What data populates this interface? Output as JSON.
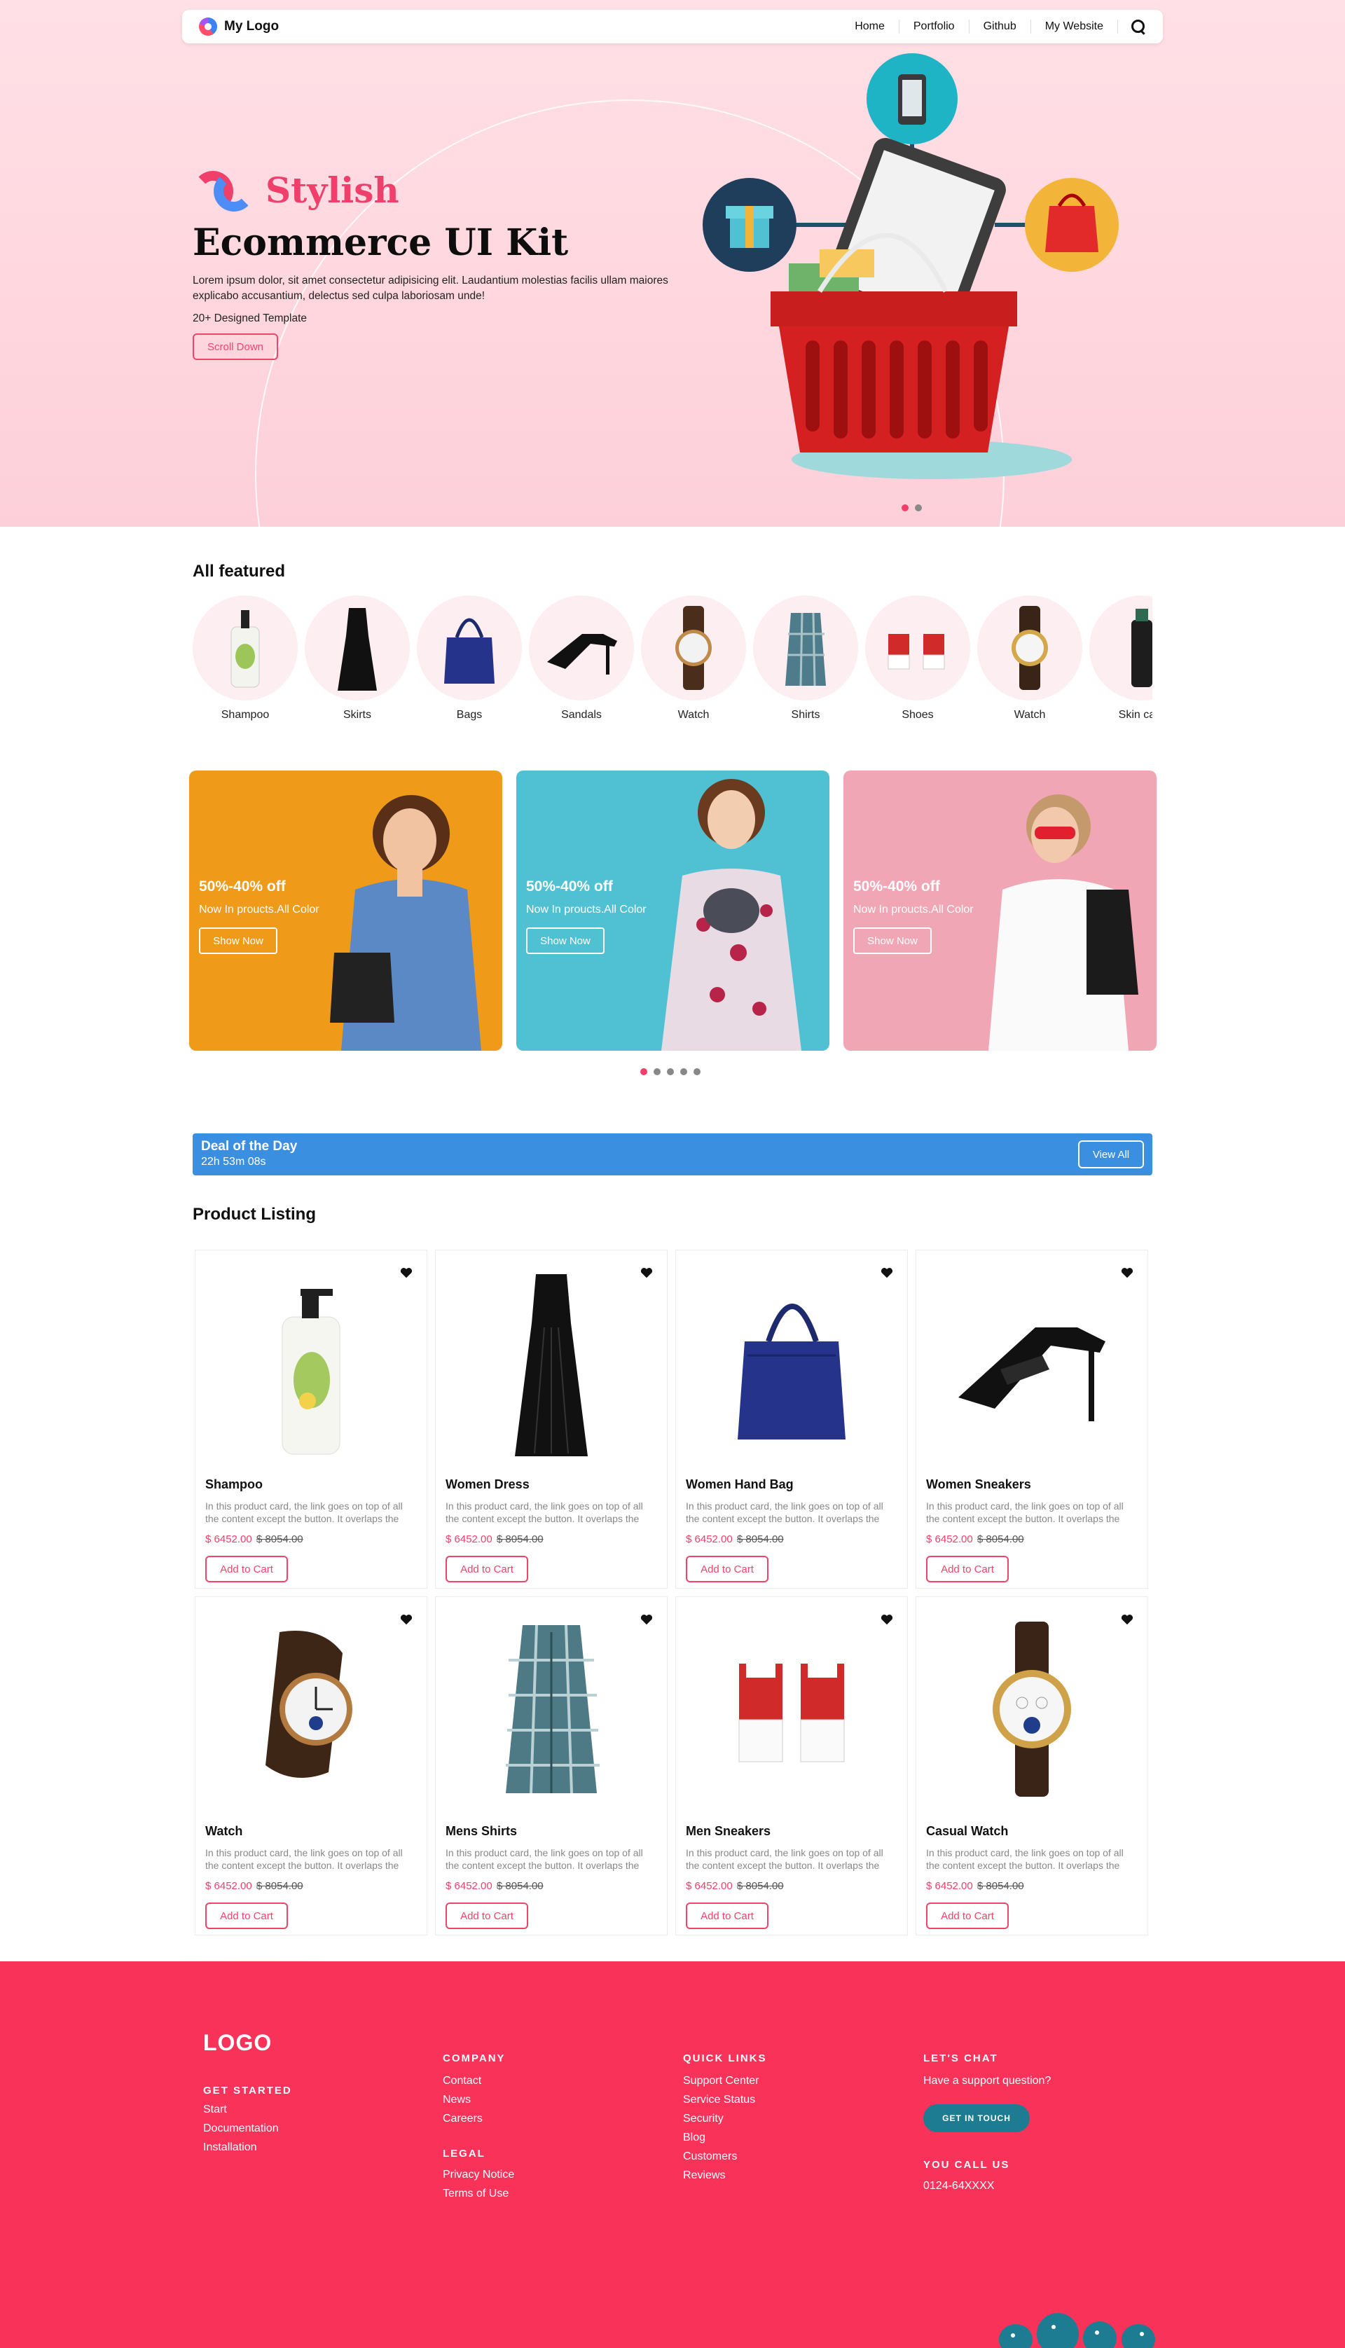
{
  "nav": {
    "brand": "My Logo",
    "links": [
      "Home",
      "Portfolio",
      "Github",
      "My Website"
    ]
  },
  "hero": {
    "logo_text": "Stylish",
    "title": "Ecommerce UI Kit",
    "description": "Lorem ipsum dolor, sit amet consectetur adipisicing elit. Laudantium molestias facilis ullam maiores explicabo accusantium, delectus sed culpa laboriosam unde!",
    "subtitle": "20+ Designed Template",
    "button": "Scroll Down"
  },
  "featured": {
    "title": "All featured",
    "items": [
      {
        "label": "Shampoo",
        "icon": "shampoo-icon"
      },
      {
        "label": "Skirts",
        "icon": "dress-icon"
      },
      {
        "label": "Bags",
        "icon": "bag-icon"
      },
      {
        "label": "Sandals",
        "icon": "sandal-icon"
      },
      {
        "label": "Watch",
        "icon": "watch-icon"
      },
      {
        "label": "Shirts",
        "icon": "shirt-icon"
      },
      {
        "label": "Shoes",
        "icon": "shoe-icon"
      },
      {
        "label": "Watch",
        "icon": "watch-icon"
      },
      {
        "label": "Skin care",
        "icon": "skincare-icon"
      }
    ]
  },
  "promos": [
    {
      "heading": "50%-40%  off",
      "subtext": "Now In proucts.All Color",
      "button": "Show Now",
      "color": "#f09a1a"
    },
    {
      "heading": "50%-40%  off",
      "subtext": "Now In proucts.All Color",
      "button": "Show Now",
      "color": "#4fc1d3"
    },
    {
      "heading": "50%-40%  off",
      "subtext": "Now In proucts.All Color",
      "button": "Show Now",
      "color": "#f0a6b4"
    }
  ],
  "deal": {
    "title": "Deal of the Day",
    "timer": "22h 53m 08s",
    "button": "View All"
  },
  "listing": {
    "title": "Product Listing",
    "description": "In this product card, the link goes on top of all the content except the button. It overlaps the image and the text.",
    "button": "Add to Cart",
    "products": [
      {
        "name": "Shampoo",
        "price": "$ 6452.00",
        "old_price": "$ 8054.00",
        "icon": "shampoo-icon"
      },
      {
        "name": "Women Dress",
        "price": "$ 6452.00",
        "old_price": "$ 8054.00",
        "icon": "dress-icon"
      },
      {
        "name": "Women Hand Bag",
        "price": "$ 6452.00",
        "old_price": "$ 8054.00",
        "icon": "bag-icon"
      },
      {
        "name": "Women Sneakers",
        "price": "$ 6452.00",
        "old_price": "$ 8054.00",
        "icon": "sandal-icon"
      },
      {
        "name": "Watch",
        "price": "$ 6452.00",
        "old_price": "$ 8054.00",
        "icon": "watch-icon"
      },
      {
        "name": "Mens Shirts",
        "price": "$ 6452.00",
        "old_price": "$ 8054.00",
        "icon": "shirt-icon"
      },
      {
        "name": "Men Sneakers",
        "price": "$ 6452.00",
        "old_price": "$ 8054.00",
        "icon": "shoe-icon"
      },
      {
        "name": "Casual Watch",
        "price": "$ 6452.00",
        "old_price": "$ 8054.00",
        "icon": "watch-icon"
      }
    ]
  },
  "footer": {
    "logo": "LOGO",
    "get_started": {
      "title": "GET STARTED",
      "links": [
        "Start",
        "Documentation",
        "Installation"
      ]
    },
    "company": {
      "title": "COMPANY",
      "links": [
        "Contact",
        "News",
        "Careers"
      ]
    },
    "legal": {
      "title": "LEGAL",
      "links": [
        "Privacy Notice",
        "Terms of Use"
      ]
    },
    "quick_links": {
      "title": "QUICK LINKS",
      "links": [
        "Support Center",
        "Service Status",
        "Security",
        "Blog",
        "Customers",
        "Reviews"
      ]
    },
    "chat": {
      "title": "LET'S CHAT",
      "text": "Have a support question?",
      "button": "GET IN TOUCH"
    },
    "call": {
      "title": "YOU CALL US",
      "phone": "0124-64XXXX"
    }
  },
  "colors": {
    "accent": "#ef3f6a",
    "deal_bar": "#3b8fe0",
    "footer": "#f9325a",
    "chat_button": "#1e7c92"
  }
}
